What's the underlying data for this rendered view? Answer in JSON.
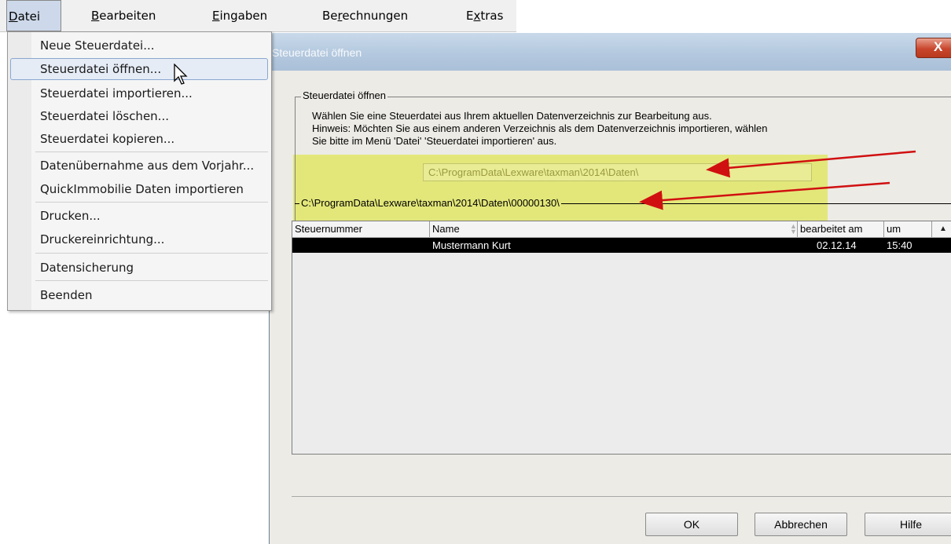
{
  "menubar": {
    "items": [
      "Datei",
      "Bearbeiten",
      "Eingaben",
      "Berechnungen",
      "Extras"
    ],
    "mnemonics": [
      "D",
      "B",
      "E",
      "r",
      "x"
    ]
  },
  "dropdown": {
    "items": [
      "Neue Steuerdatei...",
      "Steuerdatei öffnen...",
      "Steuerdatei importieren...",
      "Steuerdatei löschen...",
      "Steuerdatei kopieren...",
      "Datenübernahme aus dem Vorjahr...",
      "QuickImmobilie Daten importieren",
      "Drucken...",
      "Druckereinrichtung...",
      "Datensicherung",
      "Beenden"
    ],
    "highlighted": "Steuerdatei öffnen..."
  },
  "dialog": {
    "title": "Steuerdatei öffnen",
    "close_label": "X",
    "group_label": "Steuerdatei öffnen",
    "desc_line1": "Wählen Sie eine Steuerdatei aus Ihrem aktuellen Datenverzeichnis zur Bearbeitung aus.",
    "desc_line2": "Hinweis: Möchten Sie aus einem anderen Verzeichnis als dem Datenverzeichnis importieren, wählen",
    "desc_line3": "Sie bitte im Menü 'Datei' 'Steuerdatei importieren' aus.",
    "data_path": "C:\\ProgramData\\Lexware\\taxman\\2014\\Daten\\",
    "current_path": "C:\\ProgramData\\Lexware\\taxman\\2014\\Daten\\00000130\\",
    "table": {
      "columns": [
        "Steuernummer",
        "Name",
        "bearbeitet am",
        "um"
      ],
      "rows": [
        {
          "steuernummer": "",
          "name": "Mustermann Kurt",
          "date": "02.12.14",
          "time": "15:40"
        }
      ]
    },
    "buttons": {
      "ok": "OK",
      "cancel": "Abbrechen",
      "help": "Hilfe"
    }
  },
  "colors": {
    "highlight": "#e3e77a",
    "arrow": "#d01010",
    "selected_row": "#000000"
  }
}
